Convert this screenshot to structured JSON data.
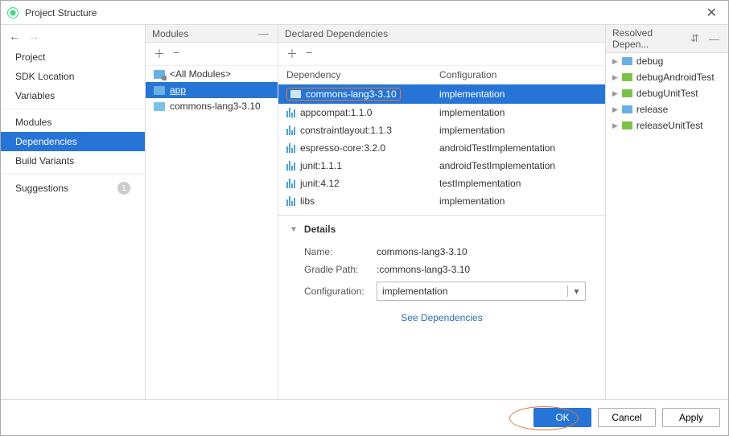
{
  "window": {
    "title": "Project Structure"
  },
  "nav": {
    "groups": [
      [
        "Project",
        "SDK Location",
        "Variables"
      ],
      [
        "Modules",
        "Dependencies",
        "Build Variants"
      ],
      [
        "Suggestions"
      ]
    ],
    "selected": "Dependencies",
    "suggestions_count": "1"
  },
  "modules_panel": {
    "title": "Modules",
    "items": [
      {
        "label": "<All Modules>",
        "icon": "all"
      },
      {
        "label": "app",
        "icon": "folder",
        "selected": true
      },
      {
        "label": "commons-lang3-3.10",
        "icon": "lib"
      }
    ]
  },
  "deps_panel": {
    "title": "Declared Dependencies",
    "columns": {
      "dep": "Dependency",
      "conf": "Configuration"
    },
    "rows": [
      {
        "name": "commons-lang3-3.10",
        "conf": "implementation",
        "icon": "folder",
        "selected": true,
        "boxed": true
      },
      {
        "name": "appcompat:1.1.0",
        "conf": "implementation",
        "icon": "lib"
      },
      {
        "name": "constraintlayout:1.1.3",
        "conf": "implementation",
        "icon": "lib"
      },
      {
        "name": "espresso-core:3.2.0",
        "conf": "androidTestImplementation",
        "icon": "lib"
      },
      {
        "name": "junit:1.1.1",
        "conf": "androidTestImplementation",
        "icon": "lib"
      },
      {
        "name": "junit:4.12",
        "conf": "testImplementation",
        "icon": "lib"
      },
      {
        "name": "libs",
        "conf": "implementation",
        "icon": "lib"
      }
    ]
  },
  "details": {
    "title": "Details",
    "name_label": "Name:",
    "name_value": "commons-lang3-3.10",
    "path_label": "Gradle Path:",
    "path_value": ":commons-lang3-3.10",
    "config_label": "Configuration:",
    "config_value": "implementation",
    "see_deps": "See Dependencies"
  },
  "resolved_panel": {
    "title": "Resolved Depen...",
    "items": [
      {
        "label": "debug",
        "color": "blue"
      },
      {
        "label": "debugAndroidTest",
        "color": "green"
      },
      {
        "label": "debugUnitTest",
        "color": "green"
      },
      {
        "label": "release",
        "color": "blue"
      },
      {
        "label": "releaseUnitTest",
        "color": "green"
      }
    ]
  },
  "footer": {
    "ok": "OK",
    "cancel": "Cancel",
    "apply": "Apply"
  }
}
